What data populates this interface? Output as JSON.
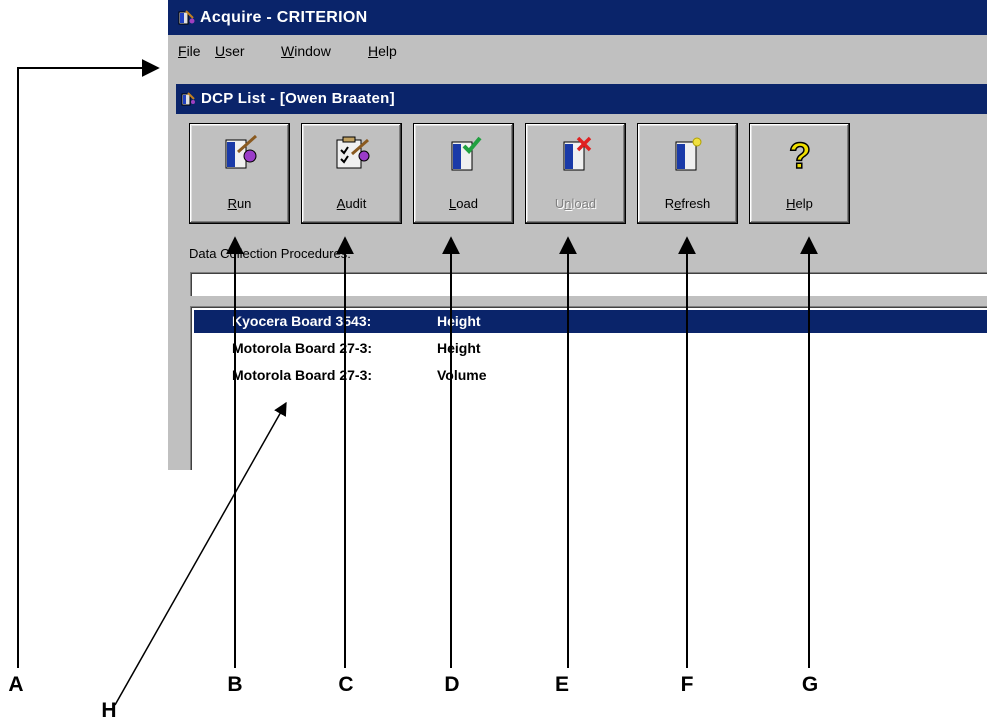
{
  "app": {
    "title": "Acquire - CRITERION",
    "menu": [
      {
        "label_accel": "F",
        "label_rest": "ile"
      },
      {
        "label_accel": "U",
        "label_rest": "ser"
      },
      {
        "label_accel": "W",
        "label_rest": "indow"
      },
      {
        "label_accel": "H",
        "label_rest": "elp"
      }
    ]
  },
  "child_window": {
    "title": "DCP List - [Owen Braaten]",
    "toolbar": [
      {
        "pre": "",
        "accel": "R",
        "post": "un",
        "icon": "run-icon",
        "enabled": true
      },
      {
        "pre": "",
        "accel": "A",
        "post": "udit",
        "icon": "audit-icon",
        "enabled": true
      },
      {
        "pre": "",
        "accel": "L",
        "post": "oad",
        "icon": "load-icon",
        "enabled": true
      },
      {
        "pre": "U",
        "accel": "n",
        "post": "load",
        "icon": "unload-icon",
        "enabled": false
      },
      {
        "pre": "R",
        "accel": "e",
        "post": "fresh",
        "icon": "refresh-icon",
        "enabled": true
      },
      {
        "pre": "",
        "accel": "H",
        "post": "elp",
        "icon": "help-icon",
        "enabled": true
      }
    ],
    "section_label": "Data Collection Procedures:",
    "filter_value": "",
    "procedures": [
      {
        "name": "Kyocera Board 3543:",
        "measure": "Height",
        "selected": true
      },
      {
        "name": "Motorola Board 27-3:",
        "measure": "Height",
        "selected": false
      },
      {
        "name": "Motorola Board 27-3:",
        "measure": "Volume",
        "selected": false
      }
    ]
  },
  "callouts": [
    "A",
    "B",
    "C",
    "D",
    "E",
    "F",
    "G",
    "H"
  ],
  "colors": {
    "titlebar": "#0a246a",
    "face": "#c0c0c0",
    "selection": "#0a246a"
  }
}
